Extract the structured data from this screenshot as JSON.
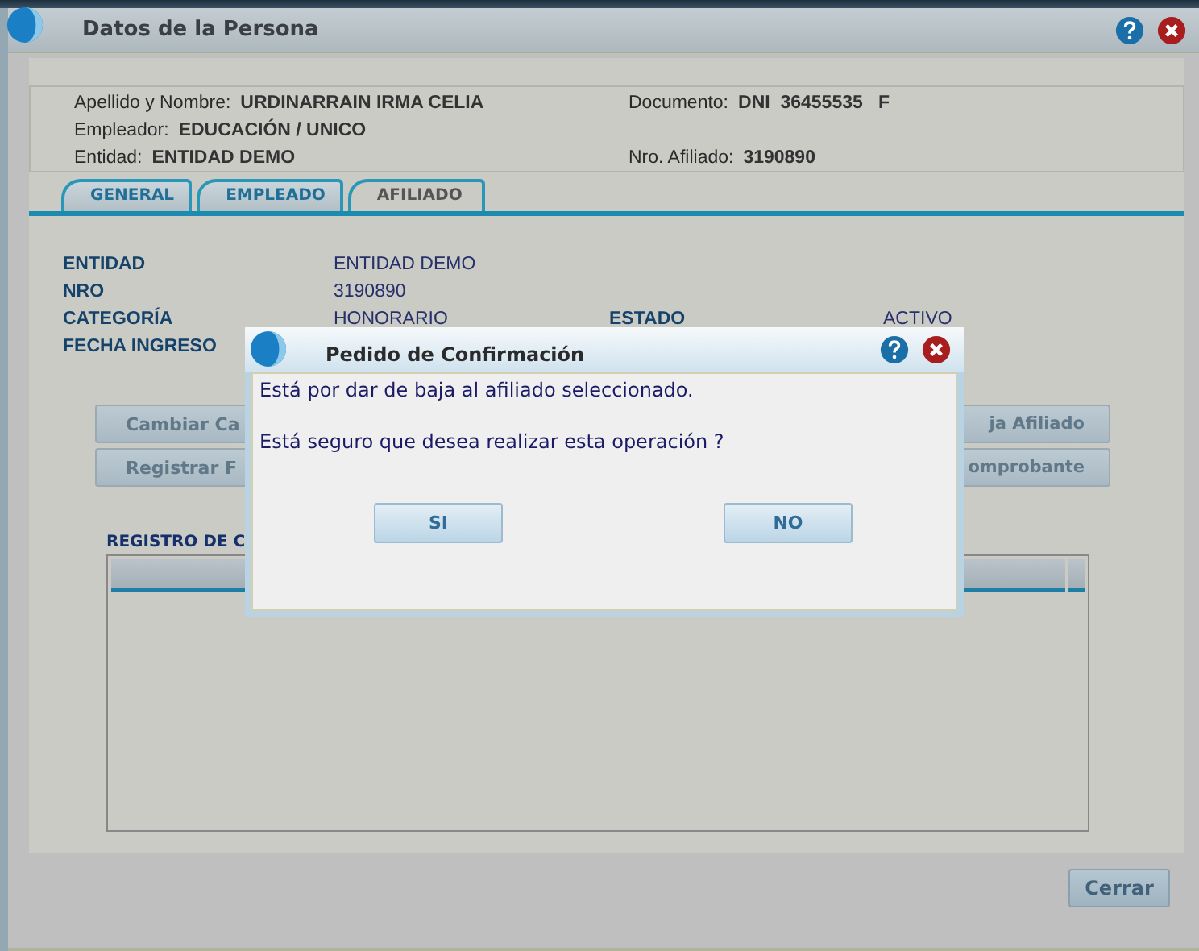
{
  "window": {
    "title": "Datos de la Persona"
  },
  "person": {
    "left": [
      {
        "label": "Apellido y Nombre:",
        "value": "URDINARRAIN IRMA CELIA"
      },
      {
        "label": "Empleador:",
        "value": "EDUCACIÓN / UNICO"
      },
      {
        "label": "Entidad:",
        "value": "ENTIDAD DEMO"
      }
    ],
    "right": [
      {
        "label": "Documento:",
        "value": "DNI  36455535   F"
      },
      {
        "label": "Nro. Afiliado:",
        "value": "3190890"
      }
    ]
  },
  "tabs": [
    {
      "label": "GENERAL",
      "selected": false
    },
    {
      "label": "EMPLEADO",
      "selected": false
    },
    {
      "label": "AFILIADO",
      "selected": true
    }
  ],
  "field_rows": [
    [
      {
        "label": "ENTIDAD",
        "value": "ENTIDAD DEMO"
      }
    ],
    [
      {
        "label": "NRO",
        "value": "3190890"
      }
    ],
    [
      {
        "label": "CATEGORÍA",
        "value": "HONORARIO"
      },
      {
        "label": "ESTADO",
        "value": "ACTIVO"
      }
    ],
    [
      {
        "label": "FECHA INGRESO"
      }
    ]
  ],
  "action_rows": [
    {
      "left": "Cambiar Ca",
      "right": "ja Afiliado"
    },
    {
      "left": "Registrar F",
      "right": "omprobante"
    }
  ],
  "registro": {
    "title": "REGISTRO DE C"
  },
  "close_button": "Cerrar",
  "dialog": {
    "title": "Pedido de Confirmación",
    "messages": [
      "Está por dar de baja al afiliado seleccionado.",
      "Está seguro que desea realizar esta operación ?"
    ],
    "buttons": [
      "SI",
      "NO"
    ]
  }
}
